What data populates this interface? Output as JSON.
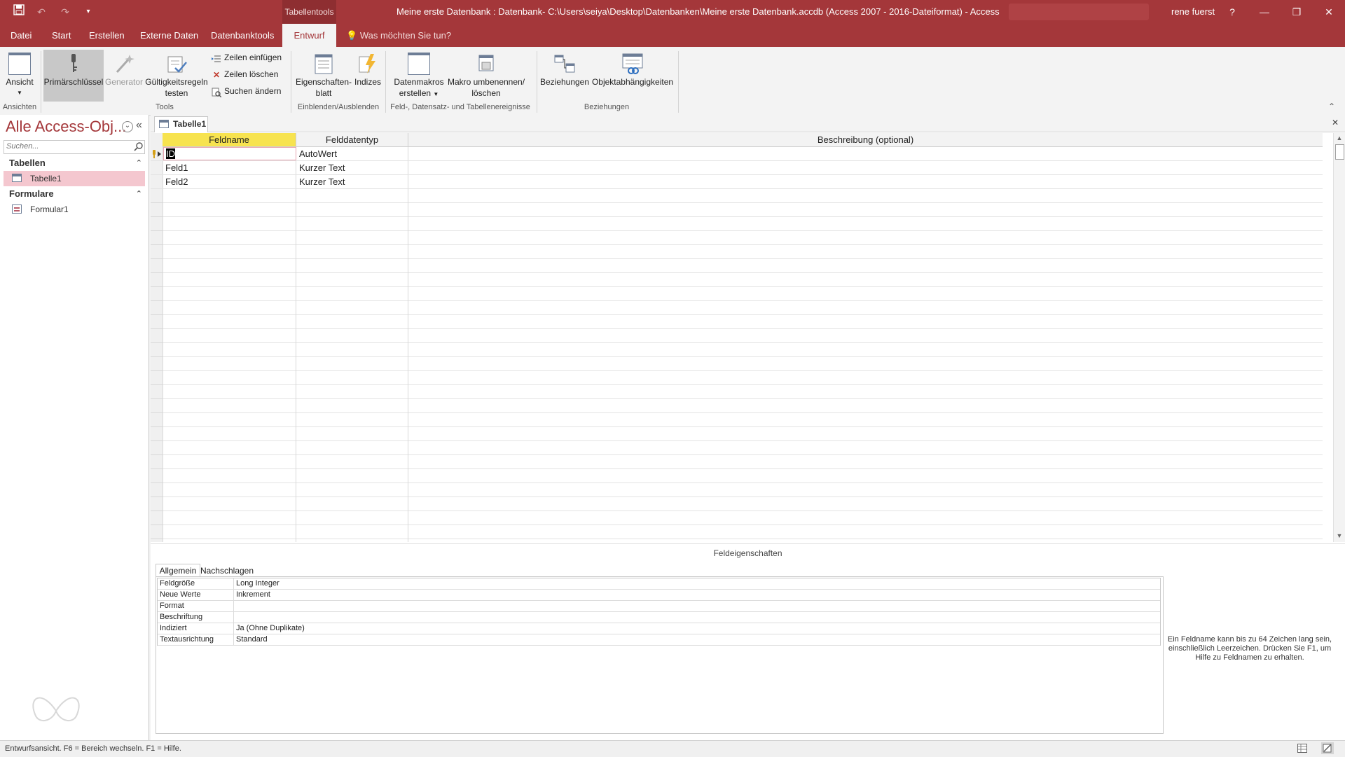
{
  "window": {
    "title": "Meine erste Datenbank : Datenbank- C:\\Users\\seiya\\Desktop\\Datenbanken\\Meine erste Datenbank.accdb (Access 2007 - 2016-Dateiformat)  -  Access",
    "context_tab_group": "Tabellentools",
    "user": "rene fuerst",
    "help": "?",
    "minimize": "—",
    "restore": "❐",
    "close": "✕"
  },
  "qat": {
    "save": "💾",
    "undo": "↶",
    "redo": "↷",
    "customize": "▾"
  },
  "tabs": [
    {
      "label": "Datei"
    },
    {
      "label": "Start"
    },
    {
      "label": "Erstellen"
    },
    {
      "label": "Externe Daten"
    },
    {
      "label": "Datenbanktools"
    },
    {
      "label": "Entwurf"
    }
  ],
  "tell_me": "Was möchten Sie tun?",
  "ribbon": {
    "ansicht": "Ansicht",
    "primaerschluessel": "Primärschlüssel",
    "generator": "Generator",
    "gueltigkeit": [
      "Gültigkeitsregeln",
      "testen"
    ],
    "zeilen_einfuegen": "Zeilen einfügen",
    "zeilen_loeschen": "Zeilen löschen",
    "suchen_aendern": "Suchen ändern",
    "eigenschaften": [
      "Eigenschaften-",
      "blatt"
    ],
    "indizes": "Indizes",
    "datenmakros": [
      "Datenmakros",
      "erstellen"
    ],
    "makro": [
      "Makro umbenennen/",
      "löschen"
    ],
    "beziehungen": "Beziehungen",
    "objektabh": "Objektabhängigkeiten",
    "groups": {
      "ansichten": "Ansichten",
      "tools": "Tools",
      "einblenden": "Einblenden/Ausblenden",
      "ereignisse": "Feld-, Datensatz- und Tabellenereignisse",
      "beziehungen": "Beziehungen"
    },
    "collapse": "⌃"
  },
  "nav": {
    "title": "Alle Access-Obj...",
    "search_placeholder": "Suchen...",
    "sections": [
      {
        "label": "Tabellen",
        "items": [
          {
            "label": "Tabelle1"
          }
        ]
      },
      {
        "label": "Formulare",
        "items": [
          {
            "label": "Formular1"
          }
        ]
      }
    ],
    "collapse": "«",
    "dropdown": "⌄",
    "section_toggle": "⌃"
  },
  "document": {
    "tab_label": "Tabelle1",
    "close": "✕",
    "columns": [
      "Feldname",
      "Felddatentyp",
      "Beschreibung (optional)"
    ],
    "rows": [
      {
        "name": "ID",
        "type": "AutoWert",
        "desc": ""
      },
      {
        "name": "Feld1",
        "type": "Kurzer Text",
        "desc": ""
      },
      {
        "name": "Feld2",
        "type": "Kurzer Text",
        "desc": ""
      }
    ],
    "field_props_label": "Feldeigenschaften",
    "prop_tabs": [
      "Allgemein",
      "Nachschlagen"
    ],
    "props": [
      {
        "label": "Feldgröße",
        "value": "Long Integer"
      },
      {
        "label": "Neue Werte",
        "value": "Inkrement"
      },
      {
        "label": "Format",
        "value": ""
      },
      {
        "label": "Beschriftung",
        "value": ""
      },
      {
        "label": "Indiziert",
        "value": "Ja (Ohne Duplikate)"
      },
      {
        "label": "Textausrichtung",
        "value": "Standard"
      }
    ],
    "help_text": "Ein Feldname kann bis zu 64 Zeichen lang sein, einschließlich Leerzeichen. Drücken Sie F1, um Hilfe zu Feldnamen zu erhalten."
  },
  "status": {
    "text": "Entwurfsansicht.  F6 = Bereich wechseln.  F1 = Hilfe."
  },
  "colors": {
    "accent": "#a4373a",
    "selection": "#f4c7cf",
    "header_active": "#f7e34f"
  }
}
